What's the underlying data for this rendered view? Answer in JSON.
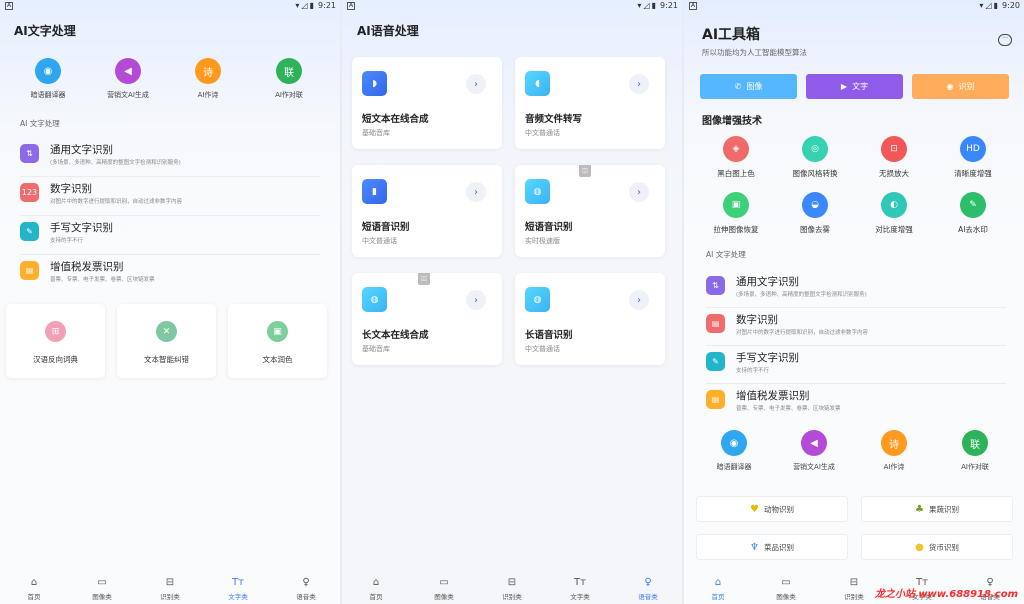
{
  "status": {
    "left_glyph": "A",
    "icons": "▾◿▮",
    "time_1": "9:21",
    "time_2": "9:21",
    "time_3": "9:20"
  },
  "p1": {
    "title": "AI文字处理",
    "quick": [
      {
        "label": "暗语翻译器",
        "color": "#2ea7ef",
        "icon": "◉"
      },
      {
        "label": "营销文AI生成",
        "color": "#b54ad7",
        "icon": "◀"
      },
      {
        "label": "AI作诗",
        "color": "#ff9a1f",
        "icon": "诗"
      },
      {
        "label": "AI作对联",
        "color": "#2fb35a",
        "icon": "联"
      }
    ],
    "section": "AI 文字处理",
    "list": [
      {
        "title": "通用文字识别",
        "desc": "(多场景、多语种、高精度的整图文字检测和识别服务)",
        "color": "#8a6ae6",
        "icon": "⇅"
      },
      {
        "title": "数字识别",
        "desc": "对图片中的数字进行提取和识别，自动过滤非数字内容",
        "color": "#f06b6b",
        "icon": "123"
      },
      {
        "title": "手写文字识别",
        "desc": "支持的字不行",
        "color": "#23b5c9",
        "icon": "✎"
      },
      {
        "title": "增值税发票识别",
        "desc": "普票、专票、电子发票、卷票、区块链发票",
        "color": "#ffaf2a",
        "icon": "▤"
      }
    ],
    "cards": [
      {
        "label": "汉语反向词典",
        "color": "#f2a0b4",
        "icon": "⊞"
      },
      {
        "label": "文本智能纠错",
        "color": "#7fc6a3",
        "icon": "✕"
      },
      {
        "label": "文本润色",
        "color": "#7ccf9a",
        "icon": "▣"
      }
    ]
  },
  "p2": {
    "title": "AI语音处理",
    "cards": [
      {
        "title": "短文本在线合成",
        "desc": "基础音库",
        "cyan": false,
        "icon": "◗",
        "badge": false
      },
      {
        "title": "音频文件转写",
        "desc": "中文普通话",
        "cyan": true,
        "icon": "◖",
        "badge": false
      },
      {
        "title": "短语音识别",
        "desc": "中文普通话",
        "cyan": false,
        "icon": "▮",
        "badge": false
      },
      {
        "title": "短语音识别",
        "desc": "实时极速版",
        "cyan": true,
        "icon": "◍",
        "badge": true
      },
      {
        "title": "长文本在线合成",
        "desc": "基础音库",
        "cyan": true,
        "icon": "◍",
        "badge": true
      },
      {
        "title": "长语音识别",
        "desc": "中文普通话",
        "cyan": true,
        "icon": "◍",
        "badge": false
      }
    ],
    "badge_glyph": "◫",
    "arrow_glyph": "›"
  },
  "p3": {
    "title": "AI工具箱",
    "subtitle": "所以功能均为人工智能模型算法",
    "chat_glyph": "···",
    "pills": [
      {
        "label": "图像",
        "color": "#55b7ff",
        "icon": "✆"
      },
      {
        "label": "文字",
        "color": "#8f5be8",
        "icon": "▶"
      },
      {
        "label": "识别",
        "color": "#ffad5c",
        "icon": "◉"
      }
    ],
    "enhance_title": "图像增强技术",
    "enhance": [
      {
        "label": "黑白图上色",
        "color": "#f16a6a",
        "icon": "◈"
      },
      {
        "label": "图像风格转换",
        "color": "#35d1b0",
        "icon": "◎"
      },
      {
        "label": "无损放大",
        "color": "#f25757",
        "icon": "⊡"
      },
      {
        "label": "清晰度增强",
        "color": "#3a88ff",
        "icon": "HD"
      },
      {
        "label": "拉伸图像恢复",
        "color": "#3dcf7a",
        "icon": "▣"
      },
      {
        "label": "图像去雾",
        "color": "#3a88ff",
        "icon": "◒"
      },
      {
        "label": "对比度增强",
        "color": "#2ec7b8",
        "icon": "◐"
      },
      {
        "label": "AI去水印",
        "color": "#2cbe6b",
        "icon": "✎"
      }
    ],
    "section": "AI 文字处理",
    "list": [
      {
        "title": "通用文字识别",
        "desc": "(多场景、多语种、高精度的整图文字检测和识别服务)",
        "color": "#8a6ae6",
        "icon": "⇅"
      },
      {
        "title": "数字识别",
        "desc": "对图片中的数字进行提取和识别，自动过滤非数字内容",
        "color": "#f06b6b",
        "icon": "▤"
      },
      {
        "title": "手写文字识别",
        "desc": "支持的字不行",
        "color": "#23b5c9",
        "icon": "✎"
      },
      {
        "title": "增值税发票识别",
        "desc": "普票、专票、电子发票、卷票、区块链发票",
        "color": "#ffaf2a",
        "icon": "▤"
      }
    ],
    "quick": [
      {
        "label": "暗语翻译器",
        "color": "#2ea7ef",
        "icon": "◉"
      },
      {
        "label": "营销文AI生成",
        "color": "#b54ad7",
        "icon": "◀"
      },
      {
        "label": "AI作诗",
        "color": "#ff9a1f",
        "icon": "诗"
      },
      {
        "label": "AI作对联",
        "color": "#2fb35a",
        "icon": "联"
      }
    ],
    "bottom": [
      {
        "label": "动物识别",
        "icon": "♥",
        "color": "#e6b800"
      },
      {
        "label": "果蔬识别",
        "icon": "♣",
        "color": "#6fa12a"
      },
      {
        "label": "菜品识别",
        "icon": "♆",
        "color": "#3a88ff"
      },
      {
        "label": "货币识别",
        "icon": "●",
        "color": "#f2c230"
      }
    ],
    "watermark": "龙之小站 www.688918.com"
  },
  "tabs": [
    {
      "label": "首页",
      "icon": "⌂"
    },
    {
      "label": "图像类",
      "icon": "▭"
    },
    {
      "label": "识别类",
      "icon": "⊟"
    },
    {
      "label": "文字类",
      "icon": "Tт"
    },
    {
      "label": "语音类",
      "icon": "♀"
    }
  ],
  "active_tab": {
    "p1": 3,
    "p2": 4,
    "p3": 0
  },
  "colors": {
    "accent": "#3a7bff"
  }
}
